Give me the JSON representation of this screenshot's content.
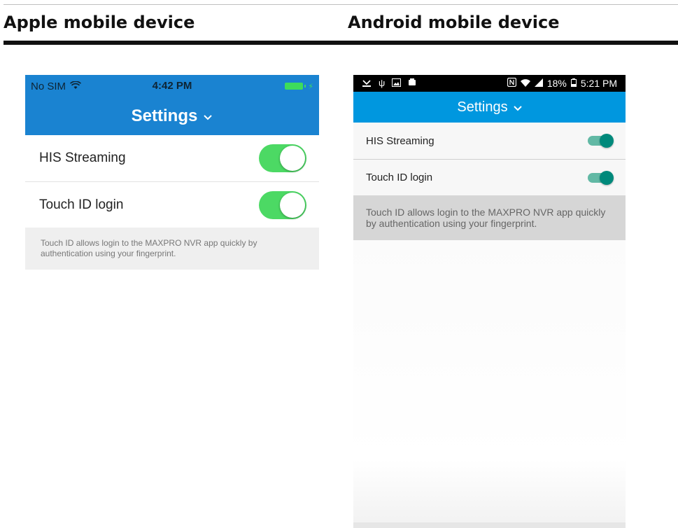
{
  "columns": {
    "apple_heading": "Apple mobile device",
    "android_heading": "Android mobile device"
  },
  "ios": {
    "carrier": "No SIM",
    "wifi_icon": "wifi-icon",
    "time": "4:42 PM",
    "header_title": "Settings",
    "rows": [
      {
        "label": "HIS Streaming",
        "enabled": true
      },
      {
        "label": "Touch ID login",
        "enabled": true
      }
    ],
    "note": "Touch ID allows login to the MAXPRO NVR app quickly by authentication using your fingerprint.",
    "colors": {
      "header": "#1a83d1",
      "switch_on": "#4cd964"
    }
  },
  "android": {
    "battery_text": "18%",
    "time": "5:21 PM",
    "header_title": "Settings",
    "rows": [
      {
        "label": "HIS Streaming",
        "enabled": true
      },
      {
        "label": "Touch ID login",
        "enabled": true
      }
    ],
    "note": "Touch ID allows login to the MAXPRO NVR app quickly by authentication using your fingerprint.",
    "colors": {
      "header": "#0097df",
      "switch_on": "#00897b"
    }
  }
}
